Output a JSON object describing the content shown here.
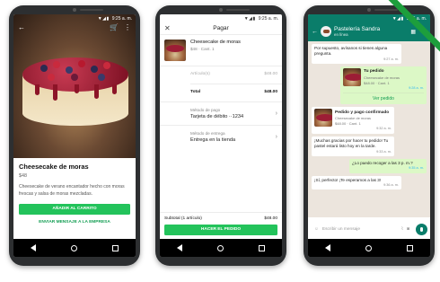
{
  "status": {
    "time": "9:25 a. m.",
    "icons": "▼◢▮"
  },
  "product_screen": {
    "title": "Cheesecake de moras",
    "price": "$48",
    "description": "Cheesecake de verano encantador hecho con moras frescas y salsa de moras mezcladas.",
    "add_to_cart": "AÑADIR AL CARRITO",
    "send_message": "ENVIAR MENSAJE A LA EMPRESA"
  },
  "checkout_screen": {
    "title": "Pagar",
    "item_title": "Cheesecake de moras",
    "item_sub": "$48 · Cant. 1",
    "items_label": "Artículo(s)",
    "items_value": "$48.00",
    "total_label": "Total",
    "total_value": "$48.00",
    "payment_label": "Método de pago",
    "payment_value": "Tarjeta de débito ··1234",
    "delivery_label": "Método de entrega",
    "delivery_value": "Entrega en la tienda",
    "subtotal_label": "Subtotal (1 artículo)",
    "subtotal_value": "$48.00",
    "place_order": "HACER EL PEDIDO"
  },
  "chat_screen": {
    "contact_name": "Pastelería Sandra",
    "contact_status": "en línea",
    "msg1": "Por supuesto, avísanos si tienes alguna pregunta.",
    "msg1_time": "9:27 a. m.",
    "order_card_title": "Tu pedido",
    "order_card_line1": "Cheesecake de moras",
    "order_card_line2": "$48.00 · Cant. 1",
    "order_card_time": "9:28 a. m.",
    "view_order": "Ver pedido",
    "confirm_title": "Pedido y pago confirmado",
    "confirm_line1": "Cheesecake de moras",
    "confirm_line2": "$48.00 · Cant. 1",
    "confirm_time": "9:32 a. m.",
    "msg3": "¡Muchas gracias por hacer tu pedido! Tu pastel estará listo hoy en la tarde.",
    "msg3_time": "9:33 a. m.",
    "msg4": "¿Lo puedo recoger a las 3 p. m.?",
    "msg4_time": "9:35 a. m.",
    "msg5": "¡Sí, perfecto! ¡Te esperamos a las 3!",
    "msg5_time": "9:36 a. m.",
    "input_placeholder": "Escribir un mensaje"
  }
}
